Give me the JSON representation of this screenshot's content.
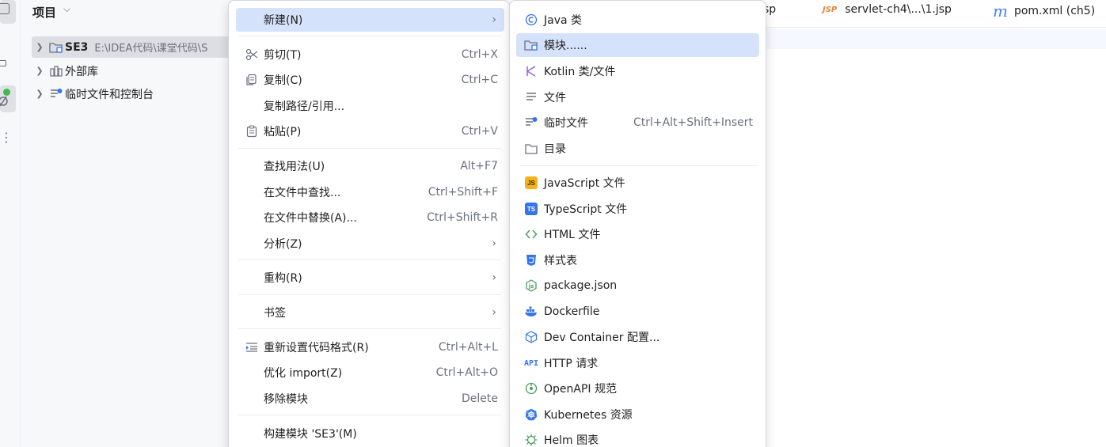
{
  "project_panel": {
    "title": "项目",
    "items": [
      {
        "name": "SE3",
        "path": "E:\\IDEA代码\\课堂代码\\S"
      },
      {
        "name": "外部库"
      },
      {
        "name": "临时文件和控制台"
      }
    ]
  },
  "tabs": [
    {
      "label": "sp"
    },
    {
      "label": "servlet-ch4\\...\\1.jsp",
      "icon_text": "JSP"
    },
    {
      "label": "pom.xml (ch5)",
      "icon_text": "m"
    }
  ],
  "context_menu": {
    "items": [
      {
        "label": "新建(N)"
      },
      {
        "label": "剪切(T)",
        "shortcut": "Ctrl+X"
      },
      {
        "label": "复制(C)",
        "shortcut": "Ctrl+C"
      },
      {
        "label": "复制路径/引用..."
      },
      {
        "label": "粘贴(P)",
        "shortcut": "Ctrl+V"
      },
      {
        "label": "查找用法(U)",
        "shortcut": "Alt+F7"
      },
      {
        "label": "在文件中查找...",
        "shortcut": "Ctrl+Shift+F"
      },
      {
        "label": "在文件中替换(A)...",
        "shortcut": "Ctrl+Shift+R"
      },
      {
        "label": "分析(Z)"
      },
      {
        "label": "重构(R)"
      },
      {
        "label": "书签"
      },
      {
        "label": "重新设置代码格式(R)",
        "shortcut": "Ctrl+Alt+L"
      },
      {
        "label": "优化 import(Z)",
        "shortcut": "Ctrl+Alt+O"
      },
      {
        "label": "移除模块",
        "shortcut": "Delete"
      },
      {
        "label": "构建模块 'SE3'(M)"
      }
    ]
  },
  "new_submenu": {
    "items": [
      {
        "label": "Java 类",
        "icon": "java-class-icon"
      },
      {
        "label": "模块......",
        "icon": "module-icon"
      },
      {
        "label": "Kotlin 类/文件",
        "icon": "kotlin-icon"
      },
      {
        "label": "文件",
        "icon": "file-icon"
      },
      {
        "label": "临时文件",
        "shortcut": "Ctrl+Alt+Shift+Insert",
        "icon": "scratch-file-icon"
      },
      {
        "label": "目录",
        "icon": "folder-icon"
      },
      {
        "label": "JavaScript 文件",
        "icon": "javascript-icon",
        "icon_text": "JS"
      },
      {
        "label": "TypeScript 文件",
        "icon": "typescript-icon",
        "icon_text": "TS"
      },
      {
        "label": "HTML 文件",
        "icon": "html-icon"
      },
      {
        "label": "样式表",
        "icon": "css-icon"
      },
      {
        "label": "package.json",
        "icon": "nodejs-icon"
      },
      {
        "label": "Dockerfile",
        "icon": "docker-icon"
      },
      {
        "label": "Dev Container 配置...",
        "icon": "dev-container-icon"
      },
      {
        "label": "HTTP 请求",
        "icon": "http-request-icon",
        "icon_text": "API"
      },
      {
        "label": "OpenAPI 规范",
        "icon": "openapi-icon"
      },
      {
        "label": "Kubernetes 资源",
        "icon": "kubernetes-icon"
      },
      {
        "label": "Helm 图表",
        "icon": "helm-icon"
      }
    ]
  },
  "colors": {
    "highlight": "#d5e2fb",
    "accent": "#3574f0",
    "muted_text": "#6c707e"
  }
}
